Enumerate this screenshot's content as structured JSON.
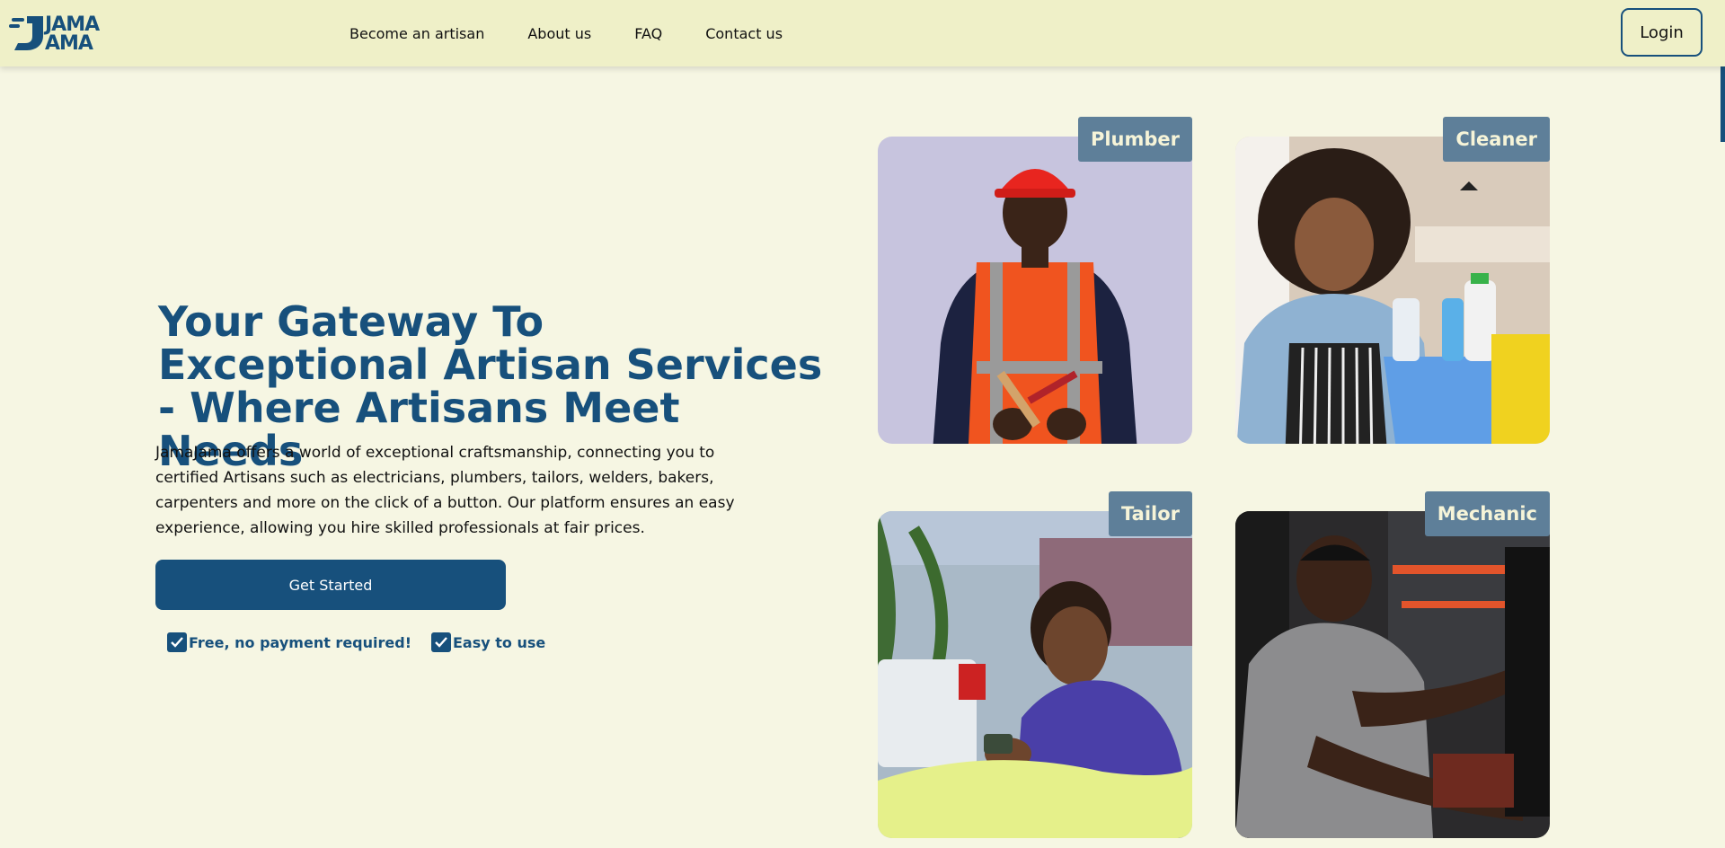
{
  "brand": {
    "logo_line1": "JAMA",
    "logo_line2": "AMA",
    "color": "#17507c"
  },
  "nav": {
    "items": [
      {
        "label": "Become an artisan"
      },
      {
        "label": "About us"
      },
      {
        "label": "FAQ"
      },
      {
        "label": "Contact us"
      }
    ],
    "login_label": "Login"
  },
  "hero": {
    "title": "Your Gateway To Exceptional Artisan Services - Where Artisans Meet Needs",
    "description": "JamaJama offers a world of exceptional craftsmanship, connecting you to certified Artisans such as electricians, plumbers, tailors, welders, bakers, carpenters and more on the click of a button. Our platform ensures an easy experience, allowing you hire skilled professionals at fair prices.",
    "cta_label": "Get Started",
    "features": [
      {
        "label": "Free, no payment required!"
      },
      {
        "label": "Easy to use"
      }
    ]
  },
  "cards": [
    {
      "tag": "Plumber",
      "icon": "plumber-photo"
    },
    {
      "tag": "Cleaner",
      "icon": "cleaner-photo"
    },
    {
      "tag": "Tailor",
      "icon": "tailor-photo"
    },
    {
      "tag": "Mechanic",
      "icon": "mechanic-photo"
    }
  ],
  "colors": {
    "background": "#f6f6e3",
    "header": "#eff0c8",
    "accent": "#17507c",
    "tag_bg": "#5e7f99"
  }
}
